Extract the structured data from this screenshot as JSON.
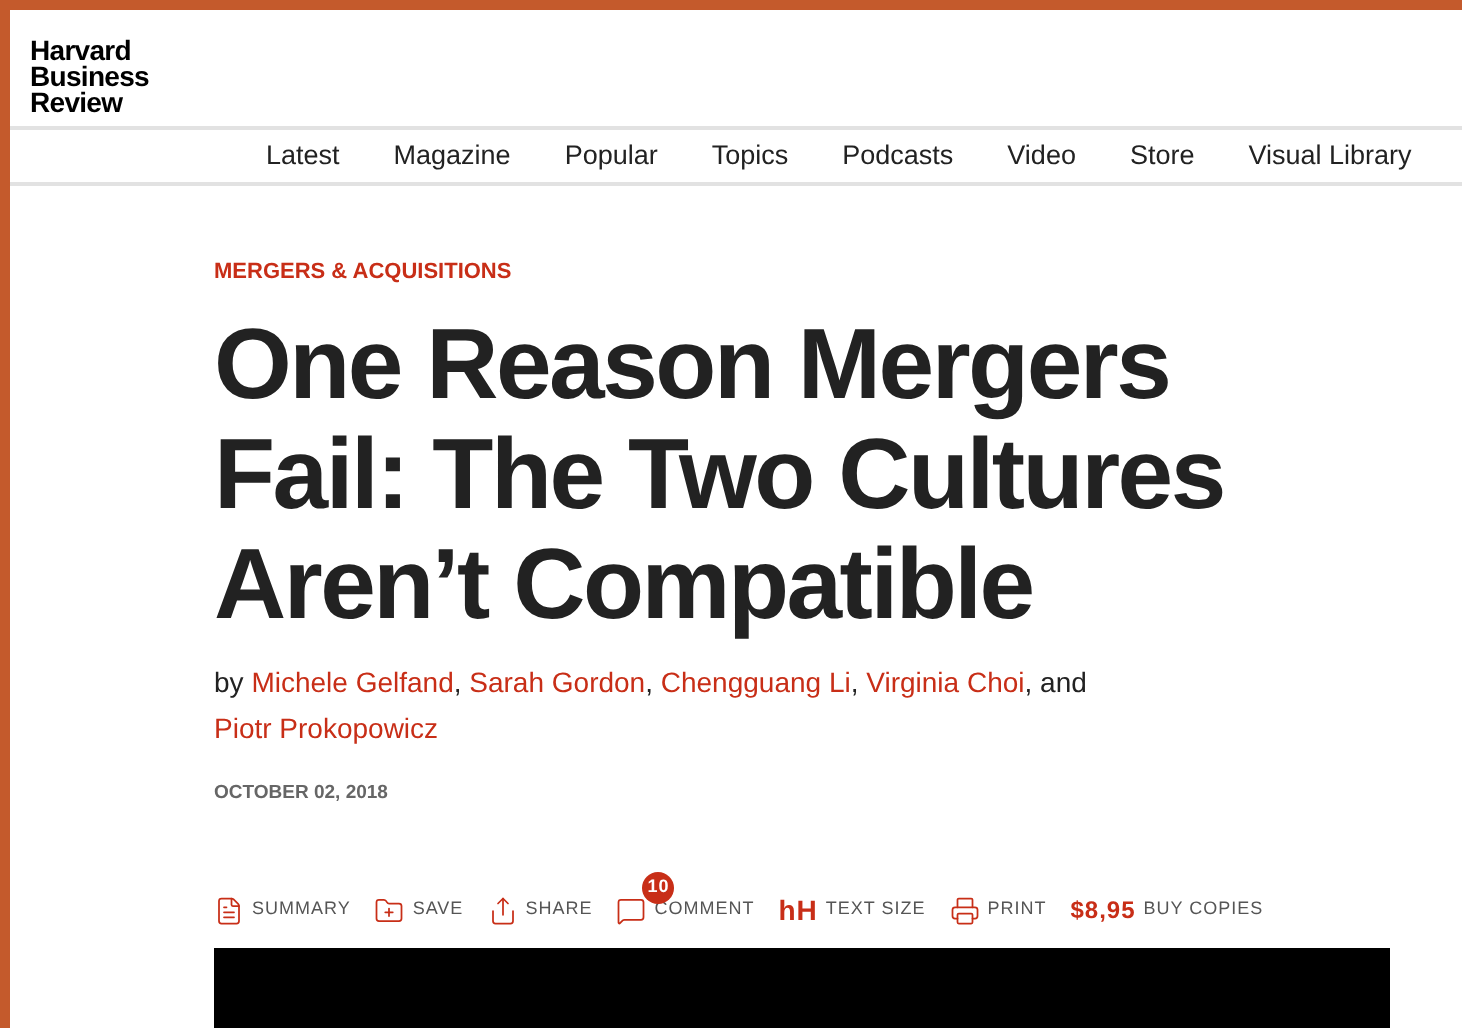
{
  "logo": {
    "lines": [
      "Harvard",
      "Business",
      "Review"
    ]
  },
  "nav": {
    "items": [
      "Latest",
      "Magazine",
      "Popular",
      "Topics",
      "Podcasts",
      "Video",
      "Store",
      "Visual Library"
    ]
  },
  "article": {
    "category": "MERGERS & ACQUISITIONS",
    "title": "One Reason Mergers Fail: The Two Cultures Aren’t Compatible",
    "byline": {
      "prefix": "by",
      "authors": [
        "Michele Gelfand",
        "Sarah Gordon",
        "Chengguang Li",
        "Virginia Choi",
        "Piotr Prokopowicz"
      ],
      "separator": ",",
      "conjunction": "and"
    },
    "date": "OCTOBER 02, 2018",
    "toolbar": [
      {
        "kind": "summary",
        "label": "SUMMARY"
      },
      {
        "kind": "save",
        "label": "SAVE"
      },
      {
        "kind": "share",
        "label": "SHARE"
      },
      {
        "kind": "comment",
        "label": "COMMENT",
        "count": "10"
      },
      {
        "kind": "textsize",
        "label": "TEXT SIZE",
        "glyph": "hH"
      },
      {
        "kind": "print",
        "label": "PRINT"
      },
      {
        "kind": "buy",
        "label": "BUY COPIES",
        "price": "$8,95"
      }
    ]
  }
}
